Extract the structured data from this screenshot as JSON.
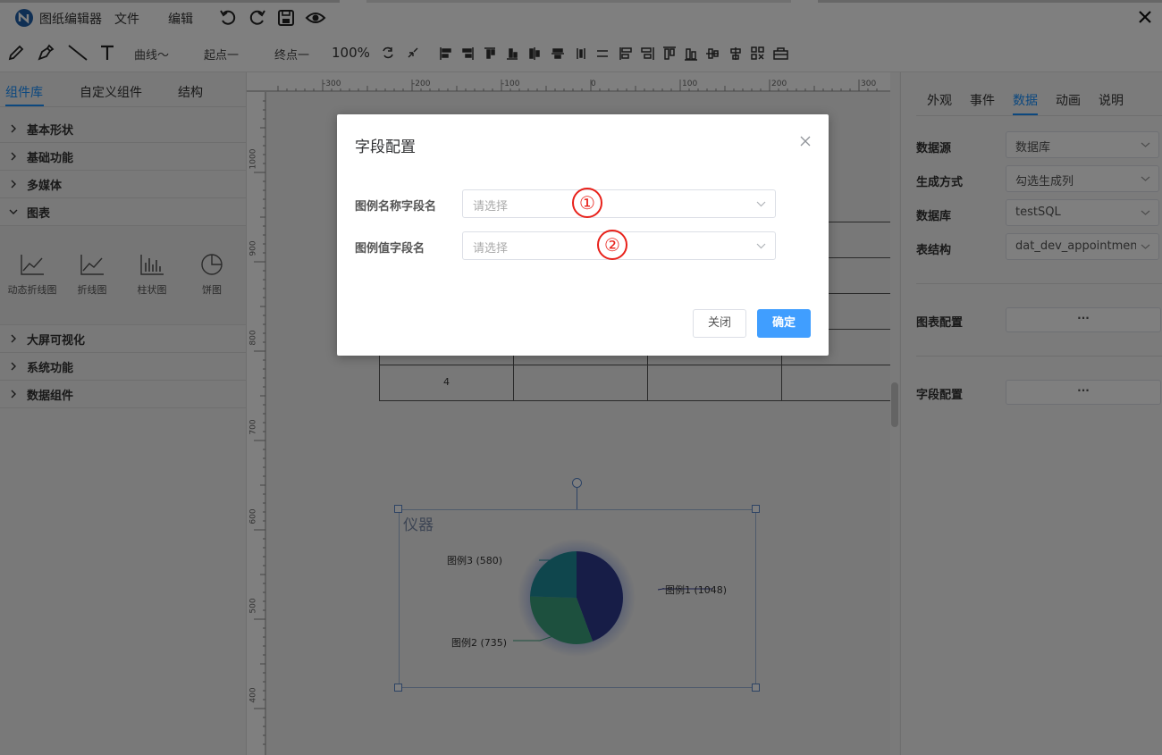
{
  "app": {
    "title": "图纸编辑器",
    "menu": {
      "file": "文件",
      "edit": "编辑"
    }
  },
  "toolbar": {
    "curve": "曲线～",
    "start_point": "起点一",
    "end_point": "终点一",
    "zoom": "100%"
  },
  "left_panel": {
    "tabs": [
      "组件库",
      "自定义组件",
      "结构"
    ],
    "categories_top": [
      "基本形状",
      "基础功能",
      "多媒体",
      "图表"
    ],
    "chart_items": [
      "动态折线图",
      "折线图",
      "柱状图",
      "饼图"
    ],
    "categories_bottom": [
      "大屏可视化",
      "系统功能",
      "数据组件"
    ]
  },
  "ruler": {
    "top": [
      "-300",
      "-200",
      "-100",
      "0",
      "100",
      "200",
      "300"
    ],
    "left": [
      "1000",
      "900",
      "800",
      "700",
      "600",
      "500",
      "400"
    ]
  },
  "canvas": {
    "table_cell": "4",
    "chart_title": "仪器",
    "pie": [
      {
        "label": "图例1 (1048)",
        "value": 1048,
        "color": "#2f3a8f"
      },
      {
        "label": "图例2 (735)",
        "value": 735,
        "color": "#3aa07c"
      },
      {
        "label": "图例3 (580)",
        "value": 580,
        "color": "#1f8c9a"
      }
    ]
  },
  "right_panel": {
    "tabs": [
      "外观",
      "事件",
      "数据",
      "动画",
      "说明"
    ],
    "data_source_label": "数据源",
    "data_source_value": "数据库",
    "gen_mode_label": "生成方式",
    "gen_mode_value": "勾选生成列",
    "database_label": "数据库",
    "database_value": "testSQL",
    "table_label": "表结构",
    "table_value": "dat_dev_appointmen",
    "chart_config_label": "图表配置",
    "field_config_label": "字段配置",
    "dots": "···"
  },
  "modal": {
    "title": "字段配置",
    "legend_name_label": "图例名称字段名",
    "legend_name_placeholder": "请选择",
    "legend_value_label": "图例值字段名",
    "legend_value_placeholder": "请选择",
    "badge1": "①",
    "badge2": "②",
    "close_button": "关闭",
    "ok_button": "确定"
  },
  "colors": {
    "accent": "#409eff",
    "tab_active": "#1890ff",
    "badge": "#e8211a"
  }
}
